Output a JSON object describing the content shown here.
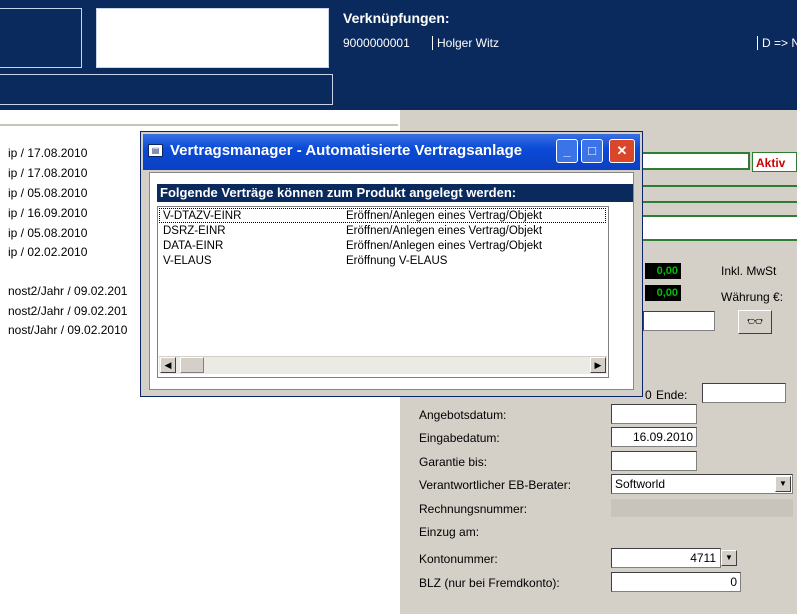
{
  "header": {
    "verknuepfungen_title": "Verknüpfungen:",
    "number": "9000000001",
    "name": "Holger Witz",
    "d_link": "D => N"
  },
  "left_list": [
    "ip / 17.08.2010",
    "ip / 17.08.2010",
    "ip / 05.08.2010",
    "ip / 16.09.2010",
    "ip / 05.08.2010",
    "ip / 02.02.2010",
    "nost2/Jahr / 09.02.201",
    "nost2/Jahr / 09.02.201",
    "nost/Jahr / 09.02.2010"
  ],
  "status": {
    "aktiv": "Aktiv"
  },
  "amounts": {
    "amount1": "0,00",
    "amount2": "0,00"
  },
  "labels": {
    "inkl_mwst": "Inkl. MwSt",
    "waehrung": "Währung €:",
    "ende": "Ende:",
    "zero_fragment": "0",
    "angebotsdatum": "Angebotsdatum:",
    "eingabedatum": "Eingabedatum:",
    "garantie_bis": "Garantie bis:",
    "eb_berater": "Verantwortlicher EB-Berater:",
    "rechnungsnummer": "Rechnungsnummer:",
    "einzug_am": "Einzug am:",
    "kontonummer": "Kontonummer:",
    "blz": "BLZ (nur bei Fremdkonto):"
  },
  "fields": {
    "eingabedatum_value": "16.09.2010",
    "eb_berater_value": "Softworld",
    "kontonummer_value": "4711",
    "blz_value": "0"
  },
  "dialog": {
    "title": "Vertragsmanager - Automatisierte Vertragsanlage",
    "header": "Folgende Verträge können zum Produkt angelegt werden:",
    "rows": [
      {
        "code": "V-DTAZV-EINR",
        "desc": "Eröffnen/Anlegen eines Vertrag/Objekt"
      },
      {
        "code": "DSRZ-EINR",
        "desc": "Eröffnen/Anlegen eines Vertrag/Objekt"
      },
      {
        "code": "DATA-EINR",
        "desc": "Eröffnen/Anlegen eines Vertrag/Objekt"
      },
      {
        "code": "V-ELAUS",
        "desc": "Eröffnung V-ELAUS"
      }
    ]
  },
  "icons": {
    "dialog_icon": "window-icon",
    "minimize": "minimize-icon",
    "maximize": "maximize-icon",
    "close": "close-icon",
    "glasses": "glasses-icon"
  },
  "colors": {
    "header_bg": "#0a2a5e",
    "panel_bg": "#d4d0c8",
    "aktiv_text": "#cc0000",
    "green_border": "#2e7d32",
    "amount_text": "#00c000"
  }
}
